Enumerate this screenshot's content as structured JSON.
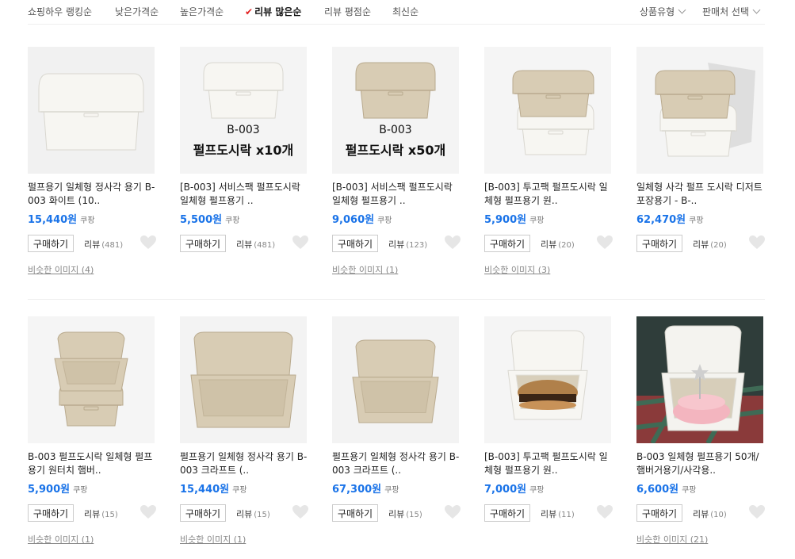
{
  "sort": {
    "options": [
      "쇼핑하우 랭킹순",
      "낮은가격순",
      "높은가격순",
      "리뷰 많은순",
      "리뷰 평점순",
      "최신순"
    ],
    "active_index": 3,
    "check_icon": "check-icon"
  },
  "filters": [
    "상품유형",
    "판매처 선택"
  ],
  "colors": {
    "price": "#1a73e8",
    "check": "#e22222"
  },
  "products": [
    {
      "title": "펄프용기 일체형 정사각 용기 B-003 화이트 (10..",
      "price": "15,440원",
      "seller": "쿠팡",
      "buy": "구매하기",
      "review_label": "리뷰",
      "review_count": "(481)",
      "similar": "비슷한 이미지 (4)",
      "image": {
        "variant": "white-single"
      }
    },
    {
      "title": "[B-003] 서비스팩 펄프도시락 일체형 펄프용기 ..",
      "price": "5,500원",
      "seller": "쿠팡",
      "buy": "구매하기",
      "review_label": "리뷰",
      "review_count": "(481)",
      "similar": "",
      "image": {
        "variant": "white-label",
        "line1": "B-003",
        "line2": "펄프도시락 x10개"
      }
    },
    {
      "title": "[B-003] 서비스팩 펄프도시락 일체형 펄프용기 ..",
      "price": "9,060원",
      "seller": "쿠팡",
      "buy": "구매하기",
      "review_label": "리뷰",
      "review_count": "(123)",
      "similar": "비슷한 이미지 (1)",
      "image": {
        "variant": "kraft-label",
        "line1": "B-003",
        "line2": "펄프도시락 x50개"
      }
    },
    {
      "title": "[B-003] 투고팩 펄프도시락 일체형 펄프용기 원..",
      "price": "5,900원",
      "seller": "쿠팡",
      "buy": "구매하기",
      "review_label": "리뷰",
      "review_count": "(20)",
      "similar": "비슷한 이미지 (3)",
      "image": {
        "variant": "stack-kraft-white"
      }
    },
    {
      "title": "일체형 사각 펄프 도시락 디저트 포장용기 - B-..",
      "price": "62,470원",
      "seller": "쿠팡",
      "buy": "구매하기",
      "review_label": "리뷰",
      "review_count": "(20)",
      "similar": "",
      "image": {
        "variant": "stack-shadow"
      }
    },
    {
      "title": "B-003 펄프도시락 일체형 펄프용기 원터치 햄버..",
      "price": "5,900원",
      "seller": "쿠팡",
      "buy": "구매하기",
      "review_label": "리뷰",
      "review_count": "(15)",
      "similar": "비슷한 이미지 (1)",
      "image": {
        "variant": "open-stack"
      }
    },
    {
      "title": "펄프용기 일체형 정사각 용기 B-003 크라프트 (..",
      "price": "15,440원",
      "seller": "쿠팡",
      "buy": "구매하기",
      "review_label": "리뷰",
      "review_count": "(15)",
      "similar": "비슷한 이미지 (1)",
      "image": {
        "variant": "open-large"
      }
    },
    {
      "title": "펄프용기 일체형 정사각 용기 B-003 크라프트 (..",
      "price": "67,300원",
      "seller": "쿠팡",
      "buy": "구매하기",
      "review_label": "리뷰",
      "review_count": "(15)",
      "similar": "",
      "image": {
        "variant": "open-small"
      }
    },
    {
      "title": "[B-003] 투고팩 펄프도시락 일체형 펄프용기 원..",
      "price": "7,000원",
      "seller": "쿠팡",
      "buy": "구매하기",
      "review_label": "리뷰",
      "review_count": "(11)",
      "similar": "",
      "image": {
        "variant": "burger"
      }
    },
    {
      "title": "B-003 일체형 펄프용기 50개/햄버거용기/사각용..",
      "price": "6,600원",
      "seller": "쿠팡",
      "buy": "구매하기",
      "review_label": "리뷰",
      "review_count": "(10)",
      "similar": "비슷한 이미지 (21)",
      "image": {
        "variant": "cake"
      }
    }
  ]
}
